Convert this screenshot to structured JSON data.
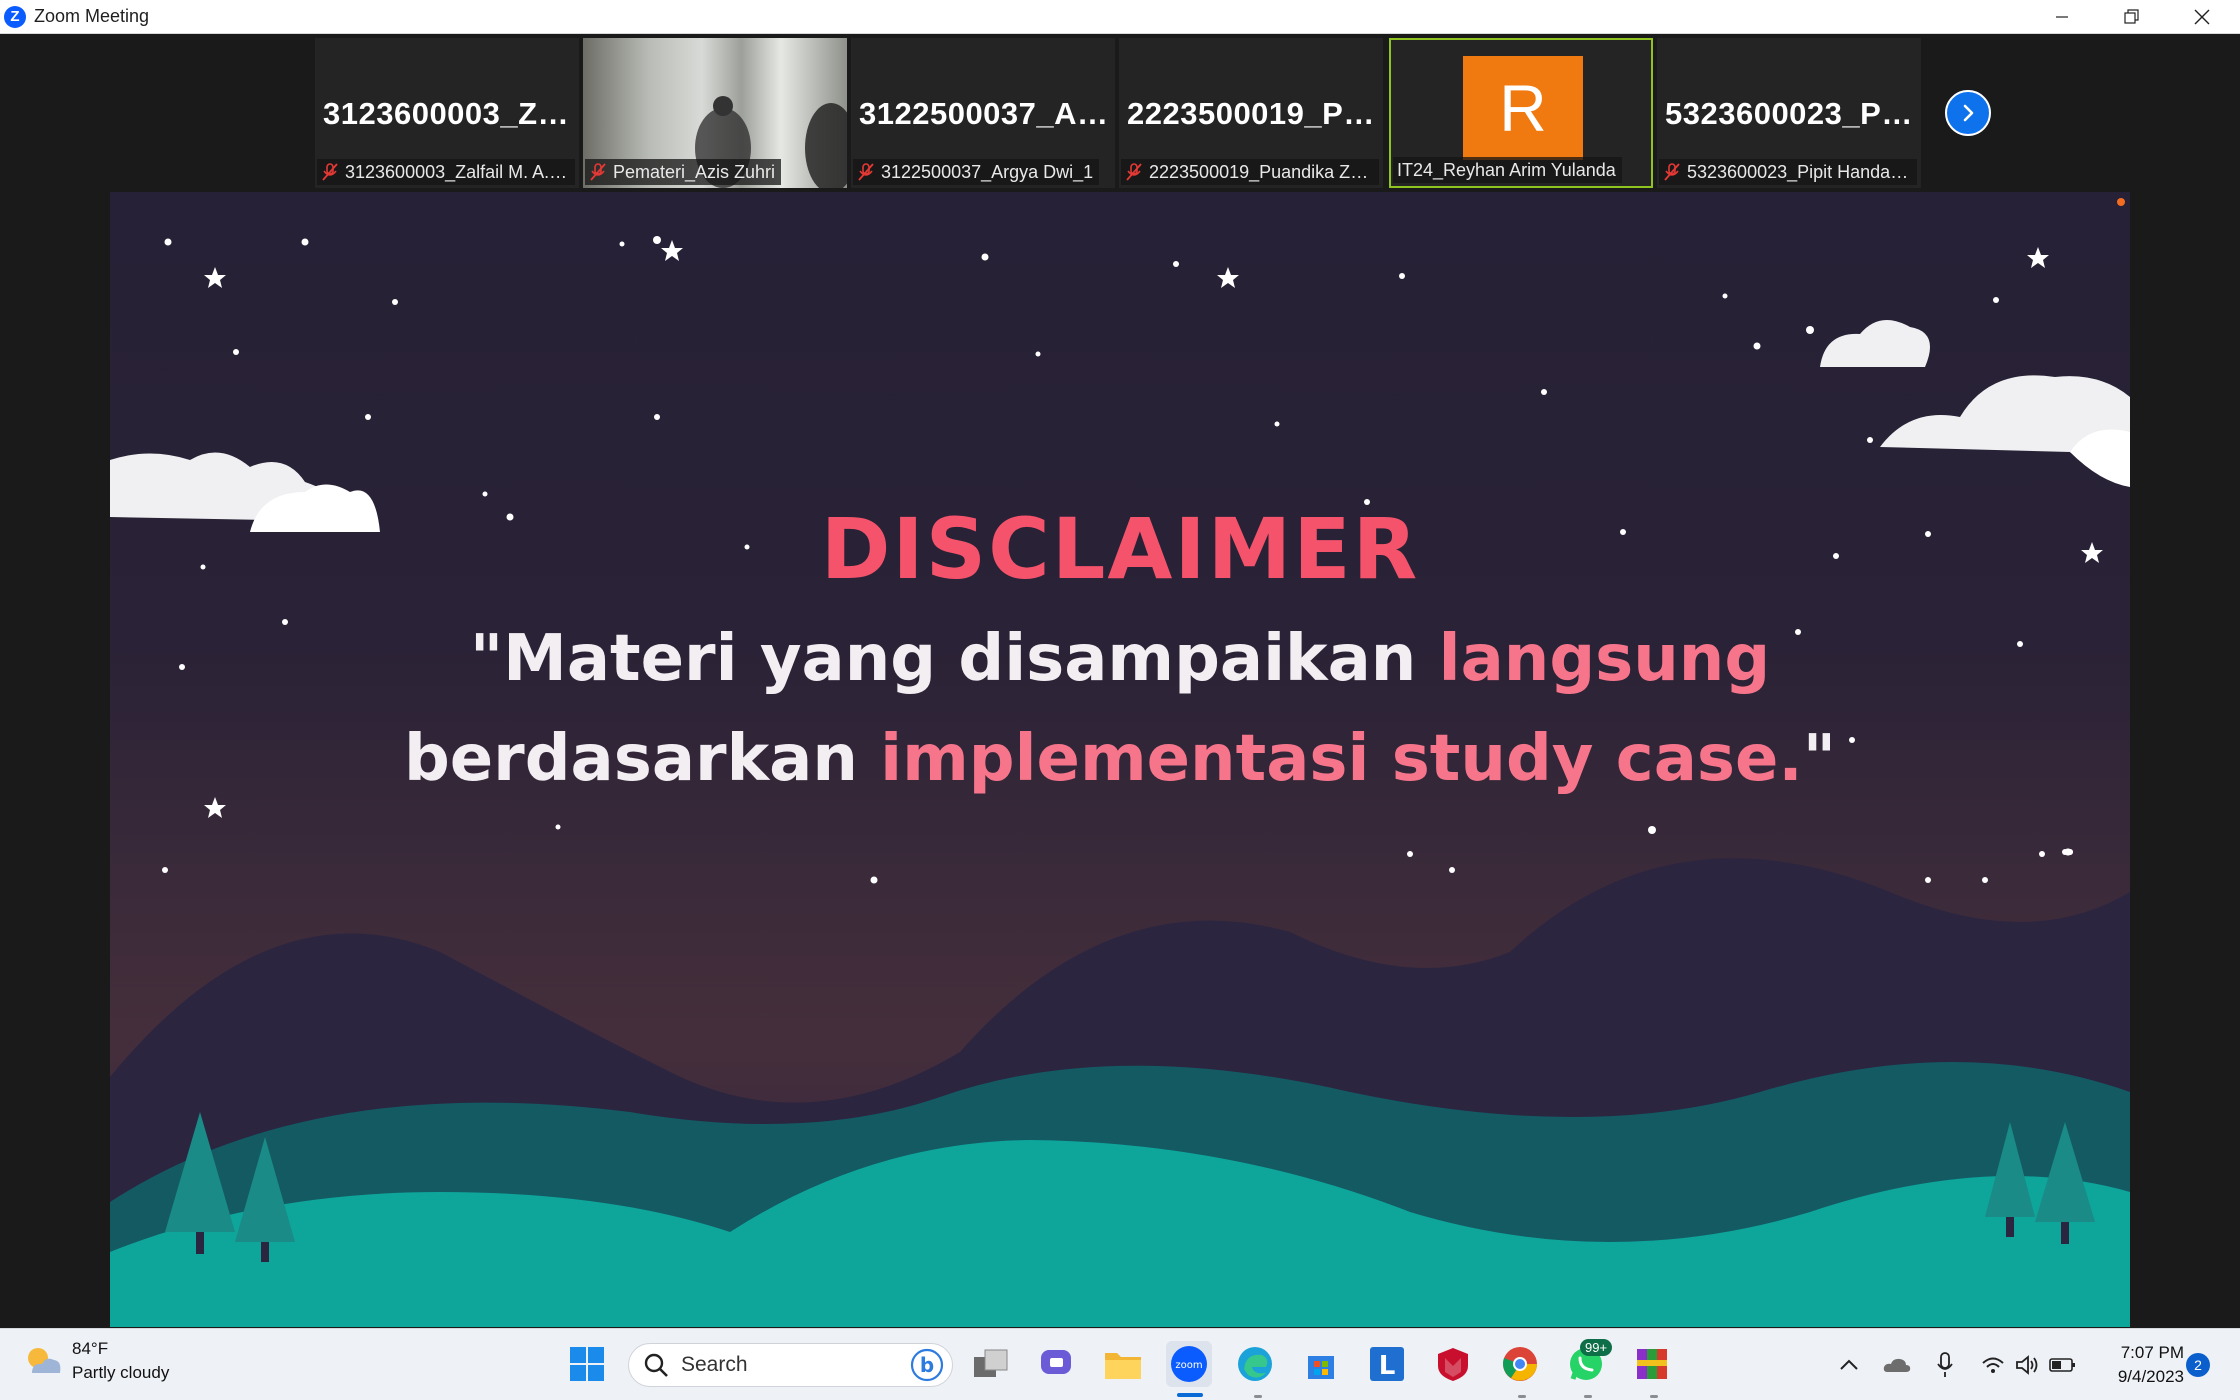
{
  "window": {
    "title": "Zoom Meeting",
    "app_icon_letter": "Z"
  },
  "participants": [
    {
      "tile_name": "3123600003_Za...",
      "label": "3123600003_Zalfail M. A._1",
      "muted": true
    },
    {
      "tile_name": "",
      "label": "Pemateri_Azis Zuhri",
      "muted": true,
      "video": true
    },
    {
      "tile_name": "3122500037_Ar...",
      "label": "3122500037_Argya Dwi_1",
      "muted": true
    },
    {
      "tile_name": "2223500019_Pu...",
      "label": "2223500019_Puandika Za...",
      "muted": true
    },
    {
      "tile_name": "",
      "label": "IT24_Reyhan Arim Yulanda",
      "muted": false,
      "avatar_letter": "R",
      "avatar_color": "#f07a10",
      "active_speaker": true
    },
    {
      "tile_name": "5323600023_Pi...",
      "label": "5323600023_Pipit Handay...",
      "muted": true
    }
  ],
  "slide": {
    "title": "DISCLAIMER",
    "line1_white": "\"Materi yang disampaikan ",
    "line1_pink": "langsung",
    "line2_white": "berdasarkan ",
    "line2_pink": "implementasi study case.",
    "line2_end": "\"",
    "colors": {
      "title": "#f4536b",
      "accent": "#f6758b",
      "text": "#f2eef2",
      "hills": "#0ea59a"
    }
  },
  "taskbar": {
    "weather_temp": "84°F",
    "weather_condition": "Partly cloudy",
    "search_placeholder": "Search",
    "whatsapp_badge": "99+",
    "time": "7:07 PM",
    "date": "9/4/2023",
    "notification_count": "2"
  }
}
